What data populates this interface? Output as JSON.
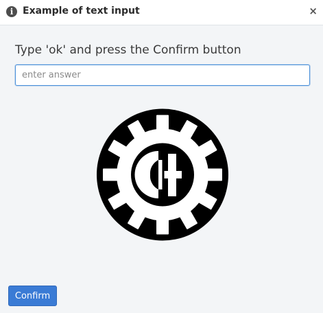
{
  "dialog": {
    "title": "Example of text input",
    "title_icon": "info-icon",
    "close_label": "×"
  },
  "main": {
    "prompt": "Type 'ok' and press the Confirm button",
    "answer_input": {
      "value": "",
      "placeholder": "enter answer"
    },
    "logo_icon": "gear-logo-icon"
  },
  "footer": {
    "confirm_label": "Confirm"
  },
  "colors": {
    "accent": "#3a7bd5",
    "focus_border": "#4a90d9",
    "background": "#f3f5f7"
  }
}
